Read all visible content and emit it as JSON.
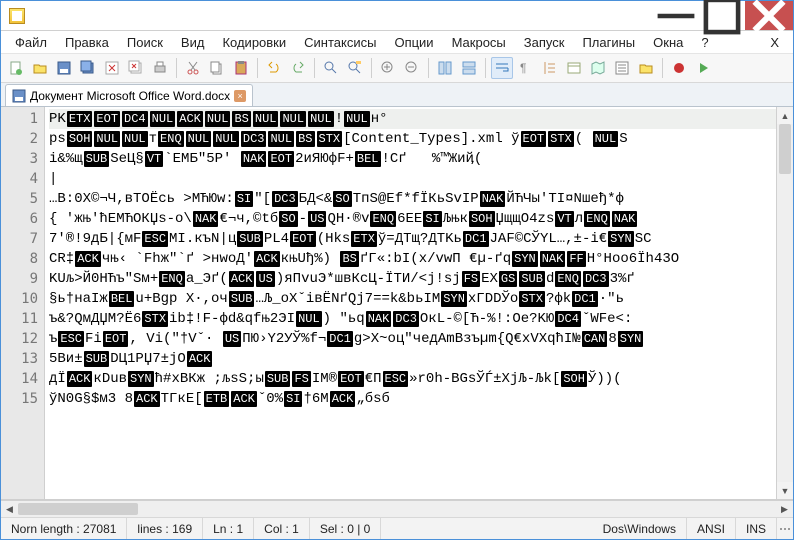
{
  "menus": [
    "Файл",
    "Правка",
    "Поиск",
    "Вид",
    "Кодировки",
    "Синтаксисы",
    "Опции",
    "Макросы",
    "Запуск",
    "Плагины",
    "Окна",
    "?",
    "X"
  ],
  "tab": {
    "label": "Документ Microsoft Office Word.docx"
  },
  "gutter_lines": [
    "1",
    "2",
    "3",
    "4",
    "5",
    "6",
    "7",
    "8",
    "9",
    "10",
    "11",
    "12",
    "13",
    "14",
    "15"
  ],
  "code_lines": [
    [
      {
        "t": "PK"
      },
      {
        "c": "ETX"
      },
      {
        "c": "EOT"
      },
      {
        "c": "DC4"
      },
      {
        "c": "NUL"
      },
      {
        "c": "ACK"
      },
      {
        "c": "NUL"
      },
      {
        "c": "BS"
      },
      {
        "c": "NUL"
      },
      {
        "c": "NUL"
      },
      {
        "c": "NUL"
      },
      {
        "t": "!"
      },
      {
        "c": "NUL"
      },
      {
        "t": "н°"
      }
    ],
    [
      {
        "t": "ps"
      },
      {
        "c": "SOH"
      },
      {
        "c": "NUL"
      },
      {
        "c": "NUL"
      },
      {
        "t": "т"
      },
      {
        "c": "ENQ"
      },
      {
        "c": "NUL"
      },
      {
        "c": "NUL"
      },
      {
        "c": "DC3"
      },
      {
        "c": "NUL"
      },
      {
        "c": "BS"
      },
      {
        "c": "STX"
      },
      {
        "t": "[Content_Types].xml ў"
      },
      {
        "c": "EOT"
      },
      {
        "c": "STX"
      },
      {
        "t": "( "
      },
      {
        "c": "NUL"
      },
      {
        "t": "S"
      }
    ],
    [
      {
        "t": "i&%щ"
      },
      {
        "c": "SUB"
      },
      {
        "t": "SeЦ§"
      },
      {
        "c": "VT"
      },
      {
        "t": "`EMБ\"5Р' "
      },
      {
        "c": "NAK"
      },
      {
        "c": "EOT"
      },
      {
        "t": "2иЯЮфF+"
      },
      {
        "c": "BEL"
      },
      {
        "t": "!Cґ   %™Жиҋ("
      }
    ],
    [
      {
        "t": "|"
      }
    ],
    [
      {
        "t": "…В:0Х©¬Ч,вTOЁсь >MЋЮw:"
      },
      {
        "c": "SI"
      },
      {
        "t": "\"["
      },
      {
        "c": "DC3"
      },
      {
        "t": "БД<&"
      },
      {
        "c": "SO"
      },
      {
        "t": "TпS@Ef*fЇКьSvIP"
      },
      {
        "c": "NAK"
      },
      {
        "t": "ЙЋЧы'TI¤Nшeђ*ф "
      }
    ],
    [
      {
        "t": "{ 'жњ'ћEMЋOКЏs-o\\"
      },
      {
        "c": "NAK"
      },
      {
        "t": "€¬ч,©tб"
      },
      {
        "c": "SO"
      },
      {
        "t": "-"
      },
      {
        "c": "US"
      },
      {
        "t": "QН·®v"
      },
      {
        "c": "ENQ"
      },
      {
        "t": "6EE"
      },
      {
        "c": "SI"
      },
      {
        "t": "Љњк"
      },
      {
        "c": "SOH"
      },
      {
        "t": "ЏщщO4zs"
      },
      {
        "c": "VT"
      },
      {
        "t": "л"
      },
      {
        "c": "ENQ"
      },
      {
        "c": "NAK"
      }
    ],
    [
      {
        "t": "7'®!9дБ|{мF"
      },
      {
        "c": "ESC"
      },
      {
        "t": "MI.къN|ц"
      },
      {
        "c": "SUB"
      },
      {
        "t": "PL4"
      },
      {
        "c": "EOT"
      },
      {
        "t": "(Hks"
      },
      {
        "c": "ETX"
      },
      {
        "t": "ў=ДTщ?ДTKь"
      },
      {
        "c": "DC1"
      },
      {
        "t": "JAF©CЎYL…,±-i€"
      },
      {
        "c": "SYN"
      },
      {
        "t": "SC"
      }
    ],
    [
      {
        "t": "CR‡"
      },
      {
        "c": "ACK"
      },
      {
        "t": "чњ‹ `Fhж\"`ґ >нwоД'"
      },
      {
        "c": "ACK"
      },
      {
        "t": "књUђ%) "
      },
      {
        "c": "BS"
      },
      {
        "t": "ґГ«:bI(x/vwП €µ-ґq"
      },
      {
        "c": "SYN"
      },
      {
        "c": "NAK"
      },
      {
        "c": "FF"
      },
      {
        "t": "H°Hoo6Їh43O"
      }
    ],
    [
      {
        "t": "KUљ>Й0НЋъ\"Sм+"
      },
      {
        "c": "ENQ"
      },
      {
        "t": "a_Эґ("
      },
      {
        "c": "ACK"
      },
      {
        "c": "US"
      },
      {
        "t": ")яПvuЭ*швКсЦ-ЇTИ/<j!sj"
      },
      {
        "c": "FS"
      },
      {
        "t": "EX"
      },
      {
        "c": "GS"
      },
      {
        "c": "SUB"
      },
      {
        "t": "d"
      },
      {
        "c": "ENQ"
      },
      {
        "c": "DC3"
      },
      {
        "t": "3%ґ"
      }
    ],
    [
      {
        "t": "§ь†наIж"
      },
      {
        "c": "BEL"
      },
      {
        "t": "u+Bgp X·,oч"
      },
      {
        "c": "SUB"
      },
      {
        "t": "…Љ_oXˇiвЁNґQj7==k&bьIM"
      },
      {
        "c": "SYN"
      },
      {
        "t": "xГDDЎo"
      },
      {
        "c": "STX"
      },
      {
        "t": "?фk"
      },
      {
        "c": "DC1"
      },
      {
        "t": "·\"ь"
      }
    ],
    [
      {
        "t": "ъ&?QмДЏM?Ё6"
      },
      {
        "c": "STX"
      },
      {
        "t": "ib‡!F-фd&qfњ2ЭI"
      },
      {
        "c": "NUL"
      },
      {
        "t": ") \"ьq"
      },
      {
        "c": "NAK"
      },
      {
        "c": "DC3"
      },
      {
        "t": "OкL-©[Ћ-%!:Oe?KЮ"
      },
      {
        "c": "DC4"
      },
      {
        "t": "ˇWFe<:"
      }
    ],
    [
      {
        "t": "ъ"
      },
      {
        "c": "ESC"
      },
      {
        "t": "Fi"
      },
      {
        "c": "EOT"
      },
      {
        "t": ", Vi(\"†Vˇ· "
      },
      {
        "c": "US"
      },
      {
        "t": "ПЮ›Y2УЎ%f¬"
      },
      {
        "c": "DC1"
      },
      {
        "t": "g>X~oц\"чедAmBзъµm{Q€xVXqћI№"
      },
      {
        "c": "CAN"
      },
      {
        "t": "8"
      },
      {
        "c": "SYN"
      }
    ],
    [
      {
        "t": "5Ви±"
      },
      {
        "c": "SUB"
      },
      {
        "t": "DЦ1PЏ7±jO"
      },
      {
        "c": "ACK"
      }
    ],
    [
      {
        "t": "дЇ"
      },
      {
        "c": "ACK"
      },
      {
        "t": "кDuв"
      },
      {
        "c": "SYN"
      },
      {
        "t": "ћ#xBКж ;љsS;ы"
      },
      {
        "c": "SUB"
      },
      {
        "c": "FS"
      },
      {
        "t": "IM®"
      },
      {
        "c": "EOT"
      },
      {
        "t": "€П"
      },
      {
        "c": "ESC"
      },
      {
        "t": "»r0h-BGsЎЃ±XjЉ-Љk["
      },
      {
        "c": "SOH"
      },
      {
        "t": "Ў))("
      }
    ],
    [
      {
        "t": "ўN0G§$м3 8"
      },
      {
        "c": "ACK"
      },
      {
        "t": "ТГкE["
      },
      {
        "c": "ETB"
      },
      {
        "c": "ACK"
      },
      {
        "t": "ˇ0%"
      },
      {
        "c": "SI"
      },
      {
        "t": "†6M"
      },
      {
        "c": "ACK"
      },
      {
        "t": "„бsб"
      }
    ]
  ],
  "status": {
    "norm_length": "Norn length : 27081",
    "lines": "lines : 169",
    "ln": "Ln : 1",
    "col": "Col : 1",
    "sel": "Sel : 0 | 0",
    "eol": "Dos\\Windows",
    "enc": "ANSI",
    "ins": "INS"
  }
}
